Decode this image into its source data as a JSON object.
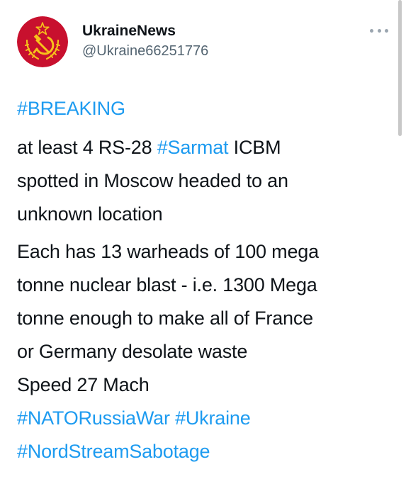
{
  "author": {
    "display_name": "UkraineNews",
    "handle": "@Ukraine66251776",
    "avatar_icon": "hammer-sickle-emblem-icon"
  },
  "menu_icon": "more-options-icon",
  "colors": {
    "link": "#1d9bf0",
    "text": "#0f1419",
    "secondary": "#536471",
    "avatar_red": "#c8102e",
    "avatar_gold": "#f6c21b"
  },
  "tweet": {
    "hashtag_breaking": "#BREAKING",
    "l1_a": "at least 4 RS-28 ",
    "l1_tag": "#Sarmat",
    "l1_b": " ICBM",
    "l2": "spotted in Moscow headed to an",
    "l3": "unknown location",
    "l4": "Each has 13 warheads of 100 mega",
    "l5": "tonne nuclear blast - i.e. 1300 Mega",
    "l6": "tonne enough to make all of France",
    "l7": "or Germany desolate waste",
    "l8": "Speed 27 Mach",
    "tag_nato": "#NATORussiaWar",
    "tag_ukraine": "#Ukraine",
    "tag_nordstream": "#NordStreamSabotage"
  }
}
